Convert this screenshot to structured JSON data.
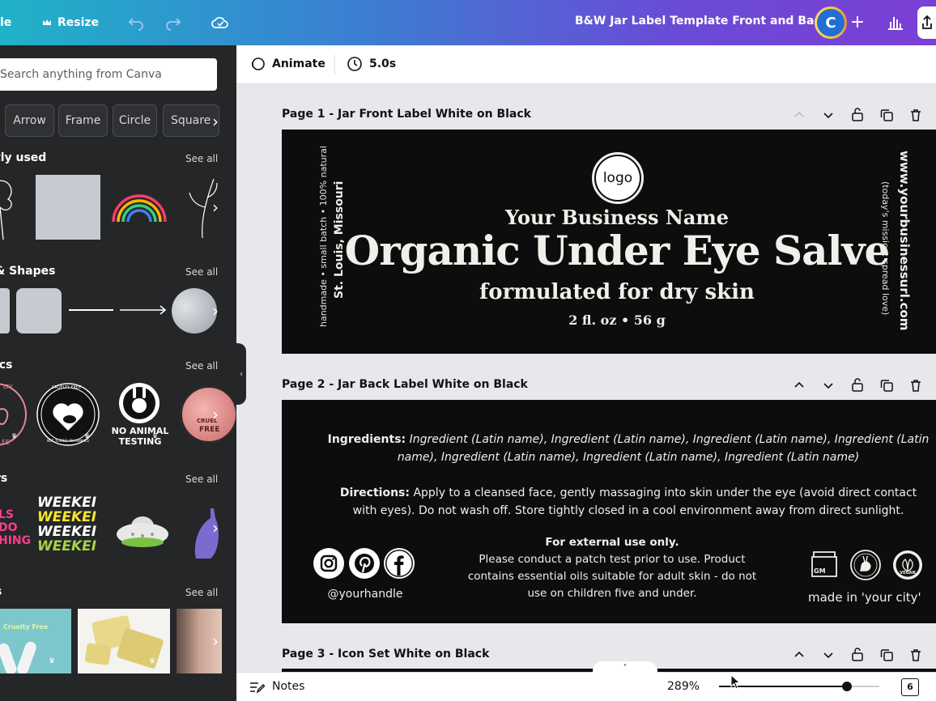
{
  "topbar": {
    "file_label": "le",
    "resize_label": "Resize",
    "doc_title": "B&W Jar Label Template Front and Back",
    "avatar_initial": "C",
    "gradient_start": "#1fb2c8",
    "gradient_end": "#7a3fd4"
  },
  "panel": {
    "search_placeholder": "Search anything from Canva",
    "chips": [
      "Arrow",
      "Frame",
      "Circle",
      "Square"
    ],
    "sections": [
      {
        "title": "tly used",
        "see_all": "See all"
      },
      {
        "title": "& Shapes",
        "see_all": "See all"
      },
      {
        "title": "ics",
        "see_all": "See all"
      },
      {
        "title": "rs",
        "see_all": "See all"
      },
      {
        "title": "s",
        "see_all": "See all"
      }
    ],
    "graphics": {
      "cruelty_free_badge": "CRUELTY FREE",
      "not_tested": "NOT TESTED ON ANIMALS",
      "no_animal_testing_1": "NO ANIMAL",
      "no_animal_testing_2": "TESTING",
      "cruelty_1": "CRUEL",
      "cruelty_2": "FREE",
      "cruelty_pink": "LTY",
      "cruelty_pink2": "EE"
    },
    "stickers": {
      "weekend": "WEEKEI",
      "pink_text_1": "LS",
      "pink_text_2": "DO",
      "pink_text_3": "HING"
    },
    "photos": {
      "cruelty_free_photo": "Cruelty Free"
    }
  },
  "toolbar": {
    "animate_label": "Animate",
    "duration_label": "5.0s"
  },
  "pages": [
    {
      "title": "Page 1 - Jar Front Label White on Black",
      "logo_text": "logo",
      "business_name": "Your Business Name",
      "product_name": "Organic Under Eye Salve",
      "formula": "formulated for dry skin",
      "size": "2 fl. oz • 56 g",
      "left_vertical_1": "handmade • small batch • 100% natural",
      "left_vertical_2": "St. Louis, Missouri",
      "right_vertical_1": "www.yourbusinessurl.com",
      "right_vertical_2": "(today's mission: spread love)"
    },
    {
      "title": "Page 2 - Jar Back Label White on Black",
      "ingredients_label": "Ingredients:",
      "ingredients_line1": " Ingredient (Latin name), Ingredient (Latin name), Ingredient (Latin name), Ingredient (Latin",
      "ingredients_line2": "name), Ingredient (Latin name), Ingredient (Latin name), Ingredient (Latin name)",
      "directions_label": "Directions:",
      "directions_line1": " Apply to a cleansed face, gently massaging into skin under the eye (avoid direct contact",
      "directions_line2": "with eyes). Do not wash off. Store tightly closed in a cool environment away from direct sunlight.",
      "external_use": "For external use only.",
      "patch_line1": "Please conduct a patch test prior to use. Product",
      "patch_line2": "contains essential oils suitable for adult skin - do not",
      "patch_line3": "use on children five and under.",
      "handle": "@yourhandle",
      "made_in": "made in 'your city'",
      "gm_badge": "GM",
      "vegan_badge": "VEGAN"
    },
    {
      "title": "Page 3 - Icon Set White on Black"
    }
  ],
  "footer": {
    "notes_label": "Notes",
    "zoom": "289%",
    "zoom_fraction": 0.8,
    "page_count": "6"
  }
}
